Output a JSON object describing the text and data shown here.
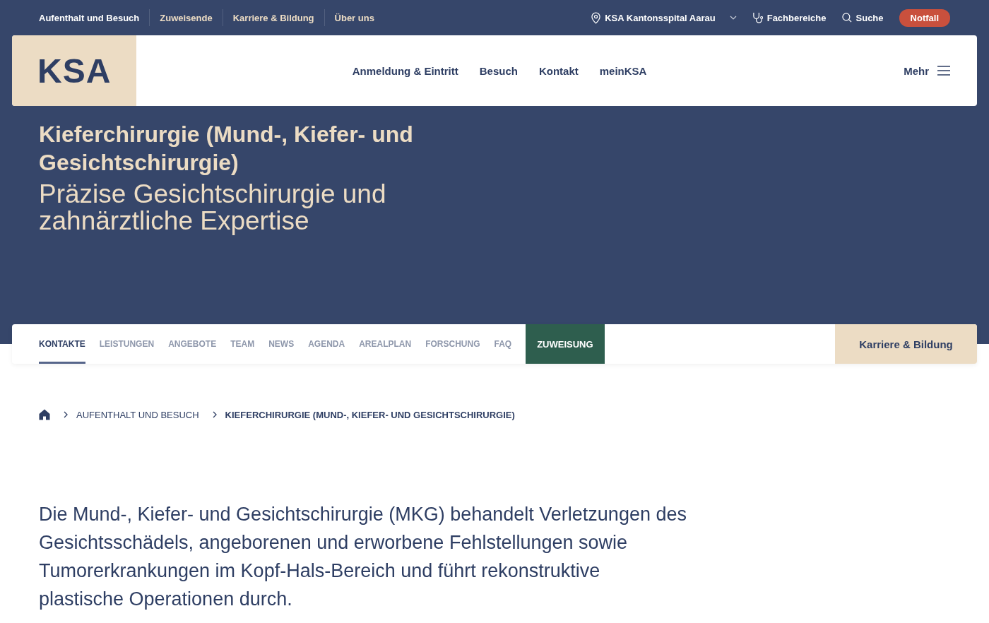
{
  "top_bar": {
    "links": [
      {
        "label": "Aufenthalt und Besuch",
        "selected": true
      },
      {
        "label": "Zuweisende",
        "selected": false
      },
      {
        "label": "Karriere & Bildung",
        "selected": false
      },
      {
        "label": "Über uns",
        "selected": false
      }
    ],
    "location": "KSA Kantonsspital Aarau",
    "departments": "Fachbereiche",
    "search": "Suche",
    "emergency": "Notfall"
  },
  "header": {
    "logo": "KSA",
    "nav": [
      "Anmeldung & Eintritt",
      "Besuch",
      "Kontakt",
      "meinKSA"
    ],
    "more": "Mehr"
  },
  "hero": {
    "title": "Kieferchirurgie (Mund-, Kiefer- und Gesichtschirurgie)",
    "subtitle": "Präzise Gesichtschirurgie und zahnärztliche Expertise"
  },
  "section_tabs": {
    "tabs": [
      {
        "label": "KONTAKTE",
        "selected": true
      },
      {
        "label": "LEISTUNGEN",
        "selected": false
      },
      {
        "label": "ANGEBOTE",
        "selected": false
      },
      {
        "label": "TEAM",
        "selected": false
      },
      {
        "label": "NEWS",
        "selected": false
      },
      {
        "label": "AGENDA",
        "selected": false
      },
      {
        "label": "AREALPLAN",
        "selected": false
      },
      {
        "label": "FORSCHUNG",
        "selected": false
      },
      {
        "label": "FAQ",
        "selected": false
      }
    ],
    "referral": "ZUWEISUNG",
    "career": "Karriere & Bildung"
  },
  "breadcrumb": {
    "items": [
      {
        "label": "AUFENTHALT UND BESUCH",
        "current": false
      },
      {
        "label": "KIEFERCHIRURGIE (MUND-, KIEFER- UND GESICHTSCHIRURGIE)",
        "current": true
      }
    ]
  },
  "intro": "Die Mund-, Kiefer- und Gesichtschirurgie (MKG) behandelt Verletzungen des Gesichtsschädels, angeborenen und erworbene Fehlstellungen sowie Tumorerkrankungen im Kopf-Hals-Bereich und führt rekonstruktive plastische Operationen durch."
}
